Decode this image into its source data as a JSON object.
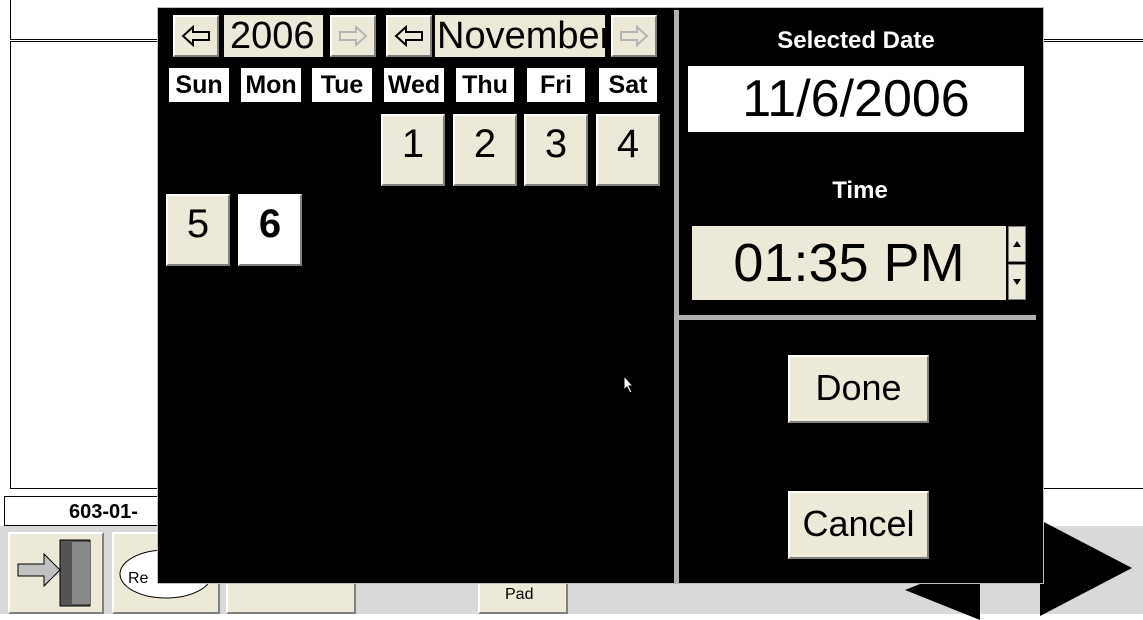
{
  "background": {
    "record_code": "603-01-",
    "cloud_button_label": "Re",
    "pad_label": "Pad"
  },
  "calendar": {
    "year": "2006",
    "month": "November",
    "weekdays": [
      "Sun",
      "Mon",
      "Tue",
      "Wed",
      "Thu",
      "Fri",
      "Sat"
    ],
    "days": [
      "1",
      "2",
      "3",
      "4",
      "5",
      "6"
    ],
    "selected_day": "6"
  },
  "selection": {
    "selected_date_label": "Selected Date",
    "selected_date": "11/6/2006",
    "time_label": "Time",
    "time_value": "01:35 PM"
  },
  "actions": {
    "done_label": "Done",
    "cancel_label": "Cancel"
  },
  "icons": {
    "prev": "left-arrow-icon",
    "next": "right-arrow-icon",
    "spin_up": "triangle-up-icon",
    "spin_down": "triangle-down-icon"
  }
}
